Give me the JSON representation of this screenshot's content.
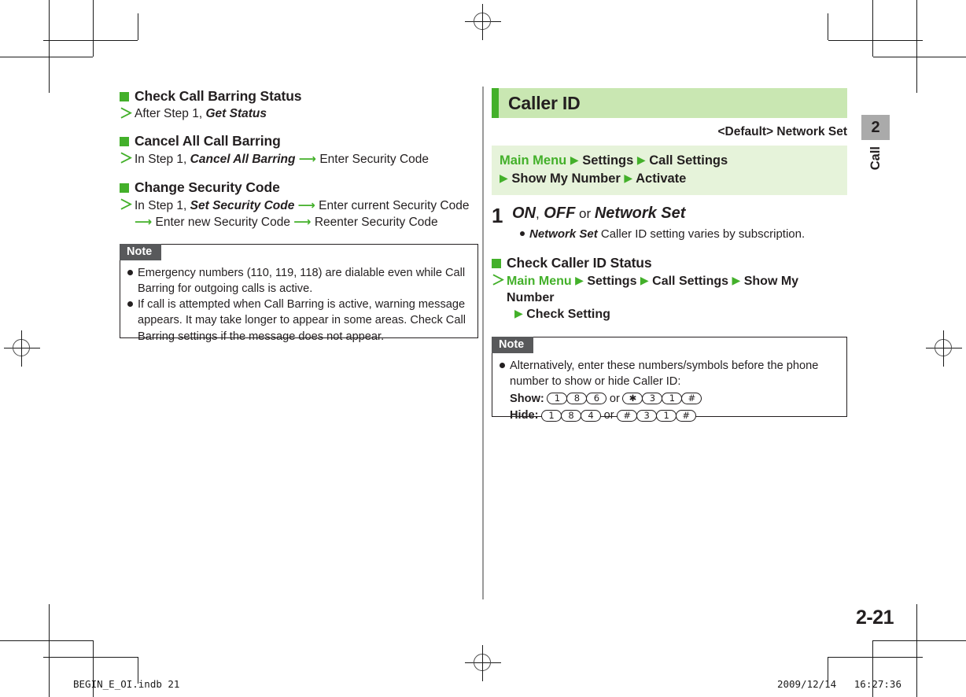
{
  "meta": {
    "page_number": "2-21",
    "chapter_number": "2",
    "chapter_label": "Call",
    "footer_file": "BEGIN_E_OI.indb   21",
    "footer_date": "2009/12/14",
    "footer_time": "16:27:36"
  },
  "colors": {
    "accent_green": "#43b02a",
    "header_band": "#c9e7b2",
    "path_band": "#e6f3da",
    "note_label_bg": "#58595b",
    "chapter_tab_bg": "#aaaaaa",
    "text": "#231f20"
  },
  "left_column": {
    "sections": [
      {
        "heading": "Check Call Barring Status",
        "steps": [
          {
            "parts": [
              {
                "text": "After Step 1, ",
                "style": "normal"
              },
              {
                "text": "Get Status",
                "style": "bold-italic"
              }
            ]
          }
        ]
      },
      {
        "heading": "Cancel All Call Barring",
        "steps": [
          {
            "parts": [
              {
                "text": "In Step 1, ",
                "style": "normal"
              },
              {
                "text": "Cancel All Barring",
                "style": "bold-italic"
              },
              {
                "text": " ",
                "style": "normal"
              },
              {
                "text": "→",
                "style": "arrow"
              },
              {
                "text": " Enter Security Code",
                "style": "normal"
              }
            ]
          }
        ]
      },
      {
        "heading": "Change Security Code",
        "steps": [
          {
            "parts": [
              {
                "text": "In Step 1, ",
                "style": "normal"
              },
              {
                "text": "Set Security Code",
                "style": "bold-italic"
              },
              {
                "text": " ",
                "style": "normal"
              },
              {
                "text": "→",
                "style": "arrow"
              },
              {
                "text": " Enter current Security Code ",
                "style": "normal"
              },
              {
                "text": "→",
                "style": "arrow"
              },
              {
                "text": " Enter new Security Code ",
                "style": "normal"
              },
              {
                "text": "→",
                "style": "arrow"
              },
              {
                "text": " Reenter Security Code",
                "style": "normal"
              }
            ]
          }
        ]
      }
    ],
    "note": {
      "label": "Note",
      "items": [
        "Emergency numbers (110, 119, 118) are dialable even while Call Barring for outgoing calls is active.",
        "If call is attempted when Call Barring is active, warning message appears. It may take longer to appear in some areas. Check Call Barring settings if the message does not appear."
      ]
    }
  },
  "right_column": {
    "section_title": "Caller ID",
    "default_line": "<Default> Network Set",
    "menu_path": [
      {
        "text": "Main Menu",
        "style": "green-bold"
      },
      {
        "text": "▶",
        "style": "triangle"
      },
      {
        "text": "Settings",
        "style": "bold"
      },
      {
        "text": "▶",
        "style": "triangle"
      },
      {
        "text": "Call Settings",
        "style": "bold"
      },
      {
        "text": "▶",
        "style": "triangle"
      },
      {
        "text": "Show My Number",
        "style": "bold"
      },
      {
        "text": "▶",
        "style": "triangle"
      },
      {
        "text": "Activate",
        "style": "bold"
      }
    ],
    "menu_path_line1": "Main Menu ▶ Settings ▶ Call Settings",
    "menu_path_line2": "▶ Show My Number ▶ Activate",
    "step": {
      "number": "1",
      "heading_parts": [
        {
          "text": "ON",
          "style": "bold-italic"
        },
        {
          "text": ", ",
          "style": "regular"
        },
        {
          "text": "OFF",
          "style": "bold-italic"
        },
        {
          "text": " or ",
          "style": "regular"
        },
        {
          "text": "Network Set",
          "style": "bold-italic"
        }
      ],
      "bullet_parts": [
        {
          "text": "Network Set",
          "style": "bold-italic"
        },
        {
          "text": " Caller ID setting varies by subscription.",
          "style": "regular"
        }
      ]
    },
    "subsection": {
      "heading": "Check Caller ID Status",
      "path_line1": "Main Menu ▶ Settings ▶ Call Settings ▶ Show My Number",
      "path_line2": "▶ Check Setting"
    },
    "note": {
      "label": "Note",
      "intro": "Alternatively, enter these numbers/symbols before the phone number to show or hide Caller ID:",
      "rows": [
        {
          "label": "Show",
          "keys_a": [
            "1",
            "8",
            "6"
          ],
          "conj": "or",
          "keys_b": [
            "✳",
            "3",
            "1",
            "#"
          ]
        },
        {
          "label": "Hide",
          "keys_a": [
            "1",
            "8",
            "4"
          ],
          "conj": "or",
          "keys_b": [
            "#",
            "3",
            "1",
            "#"
          ]
        }
      ]
    }
  }
}
